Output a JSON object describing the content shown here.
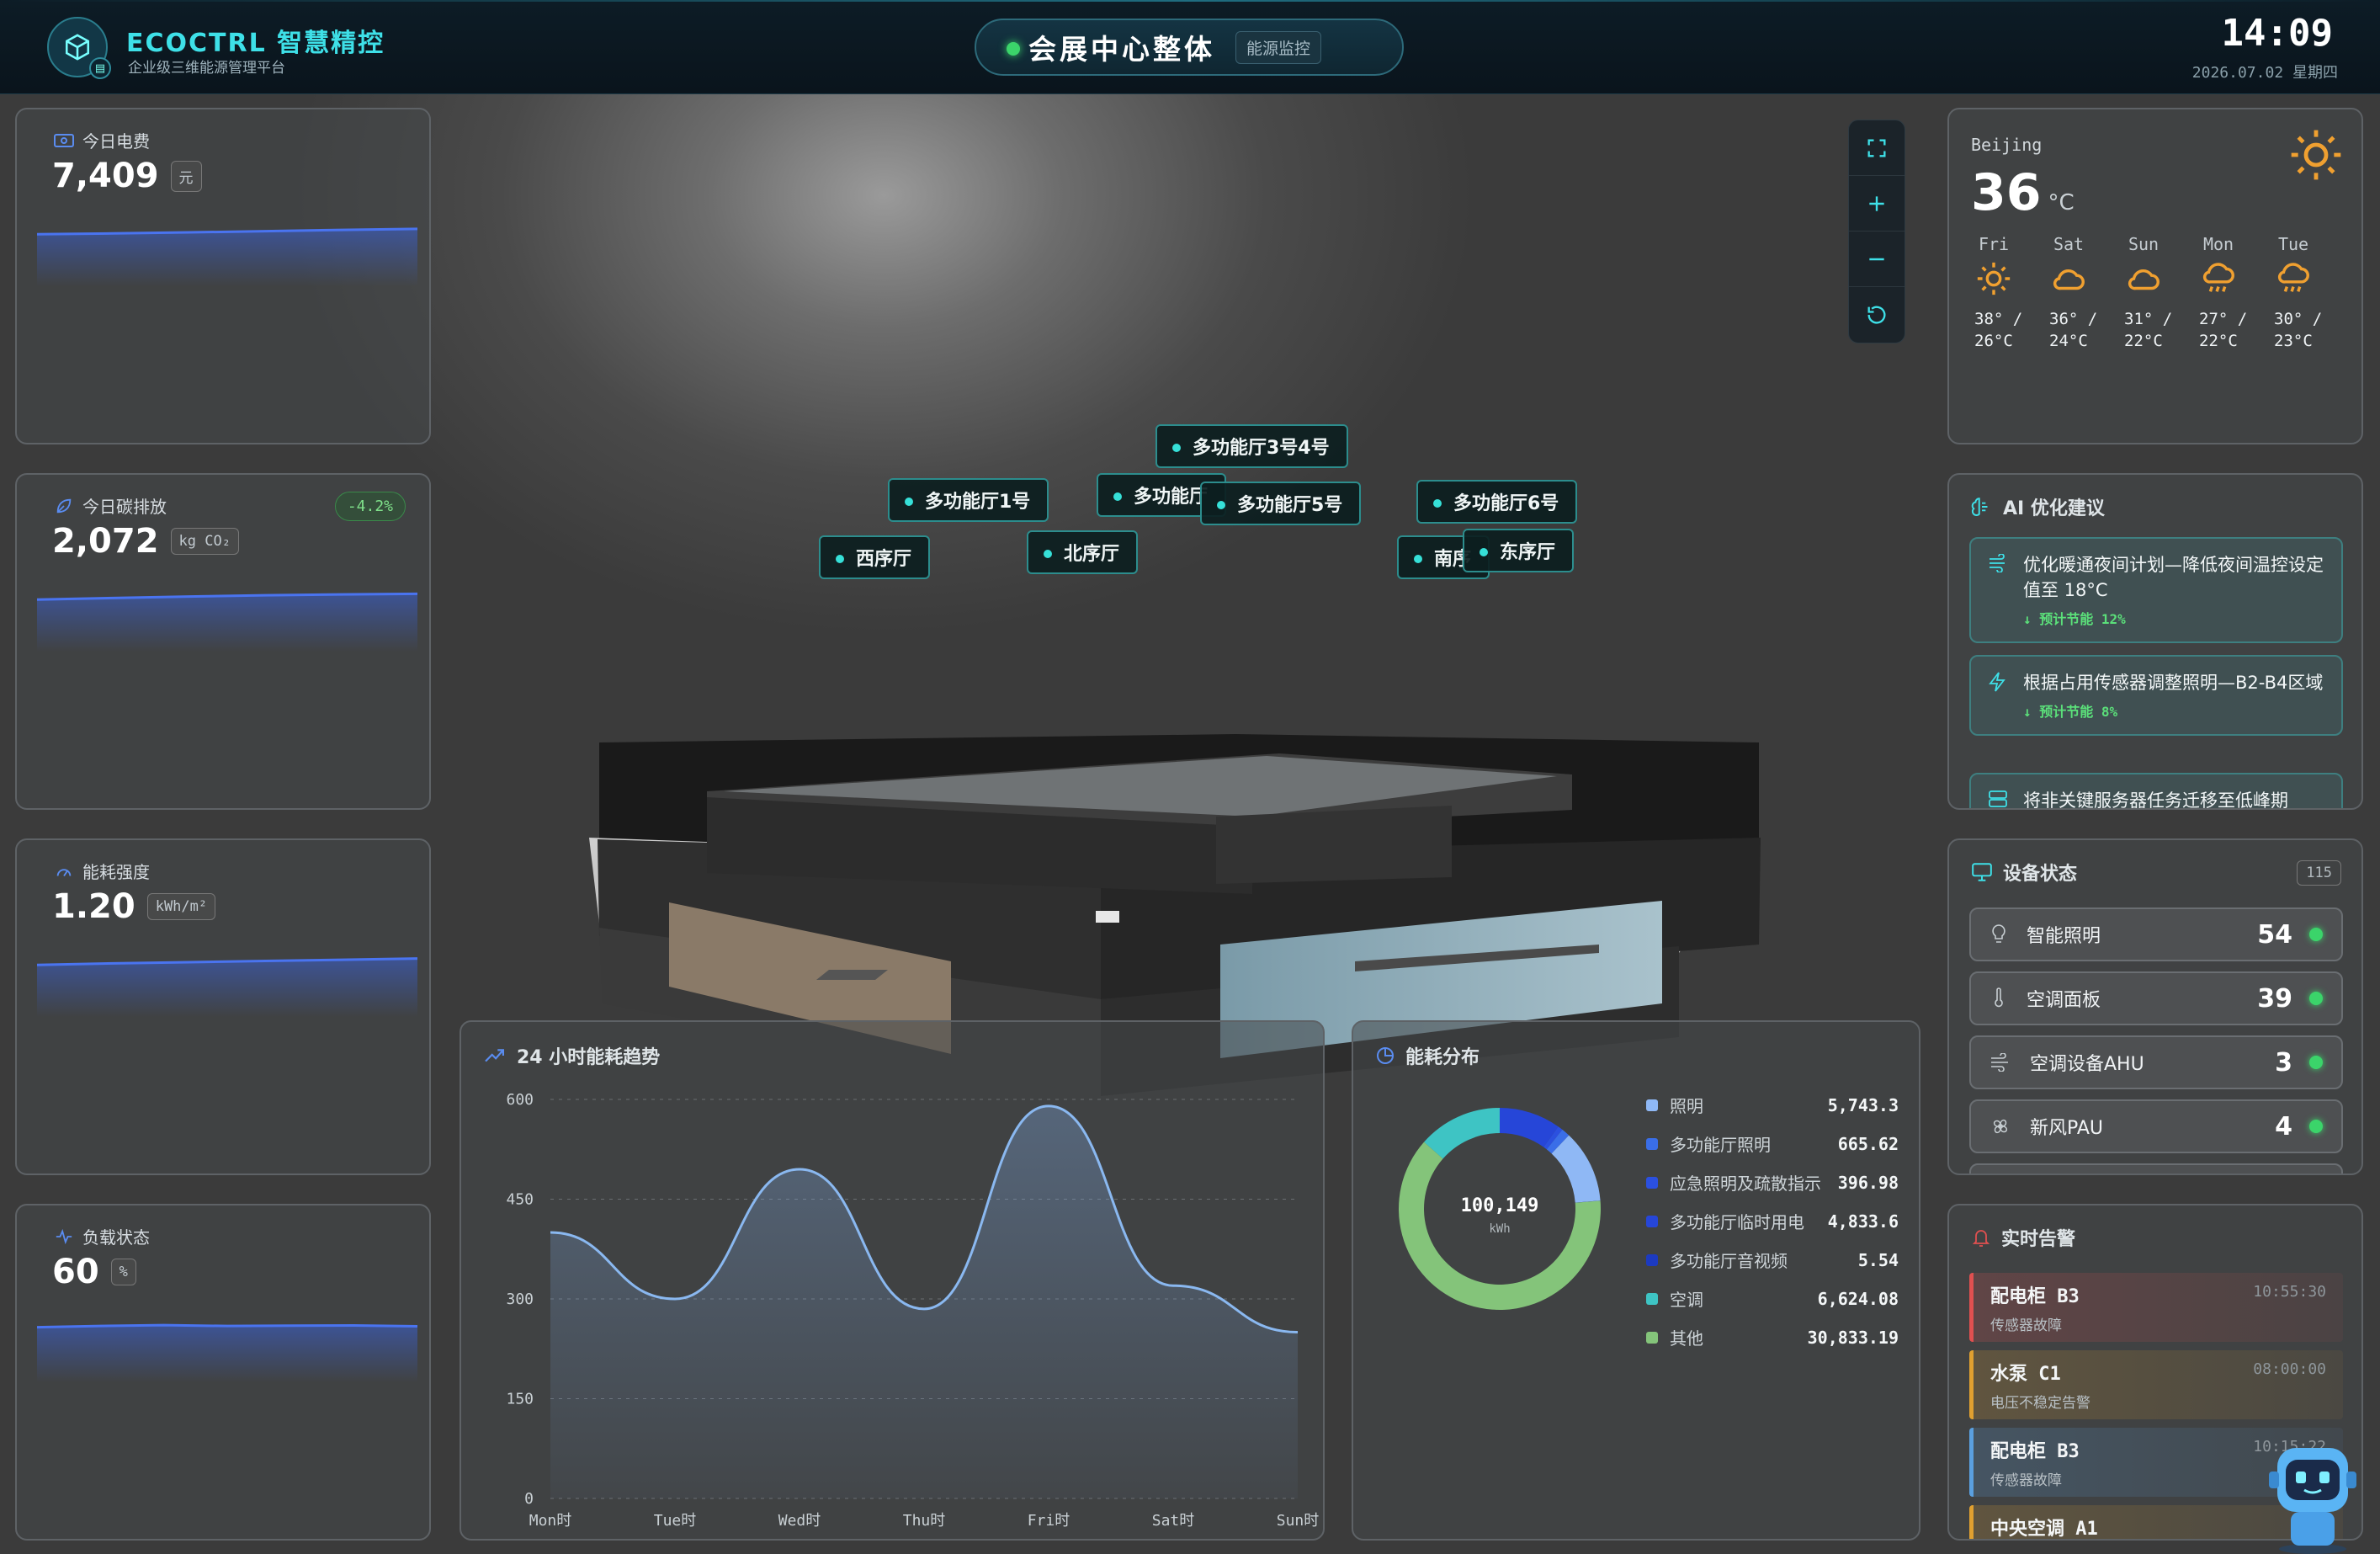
{
  "header": {
    "brand": "ECOCTRL 智慧精控",
    "brand_sub": "企业级三维能源管理平台",
    "title": "会展中心整体",
    "title_tag": "能源监控",
    "time": "14:09",
    "date": "2026.07.02 星期四"
  },
  "kpis": {
    "electricity": {
      "label": "今日电费",
      "value": "7,409",
      "unit": "元",
      "spark": [
        0.1,
        0.15,
        0.22,
        0.3,
        0.38,
        0.45
      ]
    },
    "carbon": {
      "label": "今日碳排放",
      "value": "2,072",
      "unit": "kg CO₂",
      "badge": "-4.2%",
      "spark": [
        0.1,
        0.2,
        0.3,
        0.38,
        0.44,
        0.48
      ]
    },
    "intensity": {
      "label": "能耗强度",
      "value": "1.20",
      "unit": "kWh/m²",
      "spark": [
        0.1,
        0.2,
        0.28,
        0.36,
        0.44,
        0.52
      ]
    },
    "load": {
      "label": "负载状态",
      "value": "60",
      "unit": "%",
      "spark": [
        0.3,
        0.38,
        0.44,
        0.38,
        0.4,
        0.42,
        0.36
      ]
    }
  },
  "map_labels": [
    "多功能厅3号4号",
    "多功能厅1号",
    "多功能厅",
    "多功能厅5号",
    "多功能厅6号",
    "西序厅",
    "北序厅",
    "南序",
    "东序厅"
  ],
  "weather": {
    "city": "Beijing",
    "temp": "36",
    "temp_unit": "°C",
    "icon": "sun-icon",
    "forecast": [
      {
        "day": "Fri",
        "icon": "sun-icon",
        "hi": "38° /",
        "lo": "26°C"
      },
      {
        "day": "Sat",
        "icon": "cloud-icon",
        "hi": "36° /",
        "lo": "24°C"
      },
      {
        "day": "Sun",
        "icon": "cloud-icon",
        "hi": "31° /",
        "lo": "22°C"
      },
      {
        "day": "Mon",
        "icon": "rain-icon",
        "hi": "27° /",
        "lo": "22°C"
      },
      {
        "day": "Tue",
        "icon": "rain-icon",
        "hi": "30° /",
        "lo": "23°C"
      }
    ]
  },
  "ai": {
    "title": "AI 优化建议",
    "items": [
      {
        "text": "优化暖通夜间计划—降低夜间温控设定值至 18°C",
        "saving": "↓ 预计节能 12%",
        "icon": "hvac-icon"
      },
      {
        "text": "根据占用传感器调整照明—B2-B4区域",
        "saving": "↓ 预计节能 8%",
        "icon": "lightning-icon"
      },
      {
        "text": "将非关键服务器任务迁移至低峰期",
        "saving": "",
        "icon": "server-icon"
      }
    ]
  },
  "devices": {
    "title": "设备状态",
    "total": "115",
    "items": [
      {
        "name": "智能照明",
        "count": "54",
        "icon": "bulb-icon"
      },
      {
        "name": "空调面板",
        "count": "39",
        "icon": "thermometer-icon"
      },
      {
        "name": "空调设备AHU",
        "count": "3",
        "icon": "wind-icon"
      },
      {
        "name": "新风PAU",
        "count": "4",
        "icon": "fan-icon"
      }
    ]
  },
  "alarms": {
    "title": "实时告警",
    "items": [
      {
        "name": "配电柜 B3",
        "desc": "传感器故障",
        "time": "10:55:30",
        "color": "#e05050"
      },
      {
        "name": "水泵 C1",
        "desc": "电压不稳定告警",
        "time": "08:00:00",
        "color": "#e0a030"
      },
      {
        "name": "配电柜 B3",
        "desc": "传感器故障",
        "time": "10:15:22",
        "color": "#5aa0e0"
      },
      {
        "name": "中央空调 A1",
        "desc": "",
        "time": "10:",
        "color": "#e0a030"
      }
    ]
  },
  "trend": {
    "title": "24 小时能耗趋势",
    "chart_data": {
      "type": "area",
      "title": "24 小时能耗趋势",
      "x": [
        "Mon时",
        "Tue时",
        "Wed时",
        "Thu时",
        "Fri时",
        "Sat时",
        "Sun时"
      ],
      "values": [
        400,
        300,
        495,
        285,
        590,
        320,
        250
      ],
      "ylim": [
        0,
        600
      ],
      "yticks": [
        0,
        150,
        300,
        450,
        600
      ],
      "grid": true,
      "color": "#8ab8f0"
    }
  },
  "distribution": {
    "title": "能耗分布",
    "center_value": "100,149",
    "center_unit": "kWh",
    "chart_data": {
      "type": "pie",
      "categories": [
        "照明",
        "多功能厅照明",
        "应急照明及疏散指示",
        "多功能厅临时用电",
        "多功能厅音视频",
        "空调",
        "其他"
      ],
      "values": [
        5743.3,
        665.62,
        396.98,
        4833.6,
        5.54,
        6624.08,
        30833.19
      ],
      "labels": [
        "5,743.3",
        "665.62",
        "396.98",
        "4,833.6",
        "5.54",
        "6,624.08",
        "30,833.19"
      ],
      "colors": [
        "#8fb8f5",
        "#3a6ee8",
        "#2b50e0",
        "#2646d8",
        "#1c3ac0",
        "#3ec4c4",
        "#84c47a"
      ]
    }
  }
}
